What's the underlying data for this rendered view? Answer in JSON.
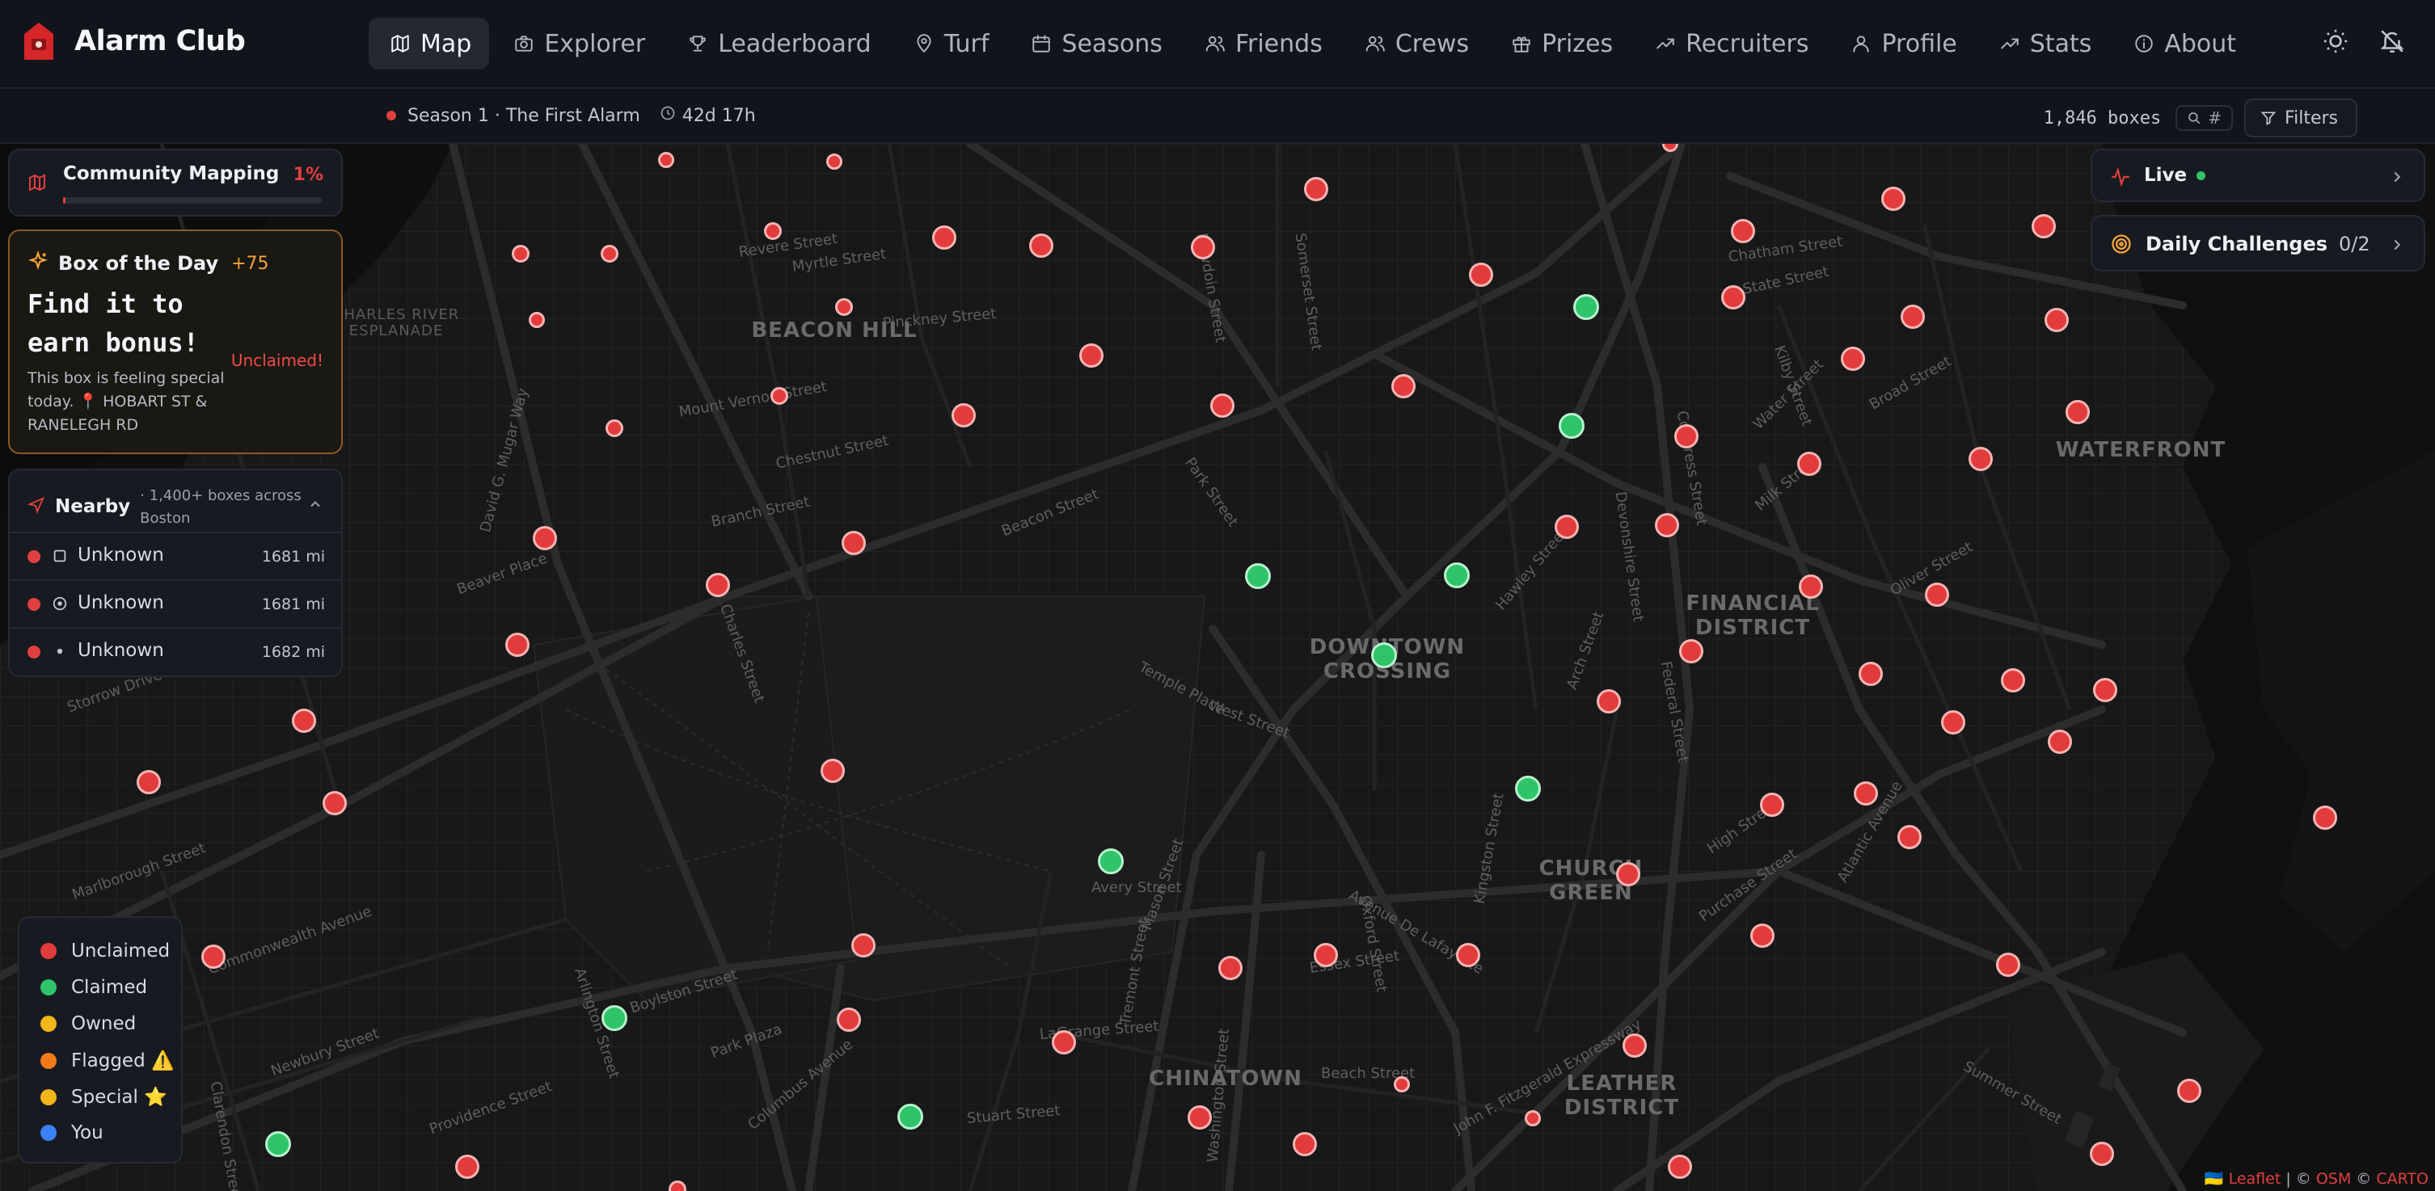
{
  "app": {
    "name": "Alarm Club"
  },
  "nav": {
    "items": [
      {
        "label": "Map",
        "icon": "map-icon",
        "active": true
      },
      {
        "label": "Explorer",
        "icon": "camera-icon"
      },
      {
        "label": "Leaderboard",
        "icon": "trophy-icon"
      },
      {
        "label": "Turf",
        "icon": "pin-icon"
      },
      {
        "label": "Seasons",
        "icon": "calendar-icon"
      },
      {
        "label": "Friends",
        "icon": "users-icon"
      },
      {
        "label": "Crews",
        "icon": "users-icon"
      },
      {
        "label": "Prizes",
        "icon": "gift-icon"
      },
      {
        "label": "Recruiters",
        "icon": "trending-icon"
      },
      {
        "label": "Profile",
        "icon": "user-icon"
      },
      {
        "label": "Stats",
        "icon": "trending-icon"
      },
      {
        "label": "About",
        "icon": "info-icon"
      }
    ]
  },
  "subbar": {
    "season": "Season 1 · The First Alarm",
    "countdown": "42d 17h",
    "box_count": "1,846 boxes",
    "search_hash": "#",
    "filters_label": "Filters"
  },
  "community": {
    "title": "Community Mapping",
    "percent_label": "1%",
    "progress": 0.01
  },
  "box_of_day": {
    "title": "Box of the Day",
    "bonus": "+75",
    "headline": "Find it to earn bonus!",
    "status": "Unclaimed!",
    "description": "This box is feeling special today. 📍 HOBART ST & RANELEGH RD"
  },
  "nearby": {
    "title": "Nearby",
    "subtitle": "· 1,400+ boxes across Boston",
    "items": [
      {
        "name": "Unknown",
        "distance": "1681 mi",
        "icon": "square-icon"
      },
      {
        "name": "Unknown",
        "distance": "1681 mi",
        "icon": "target-icon"
      },
      {
        "name": "Unknown",
        "distance": "1682 mi",
        "icon": "dot-icon"
      }
    ]
  },
  "legend": {
    "items": [
      {
        "label": "Unclaimed",
        "color": "#e23b3b"
      },
      {
        "label": "Claimed",
        "color": "#2fc46a"
      },
      {
        "label": "Owned",
        "color": "#f0b61a"
      },
      {
        "label": "Flagged ⚠️",
        "color": "#f07a1a"
      },
      {
        "label": "Special ⭐",
        "color": "#f0b61a"
      },
      {
        "label": "You",
        "color": "#3b82f6"
      }
    ]
  },
  "live": {
    "label": "Live"
  },
  "daily": {
    "label": "Daily Challenges",
    "count": "0/2"
  },
  "attribution": {
    "leaflet": "🇺🇦 Leaflet",
    "sep": " | © ",
    "osm": "OSM",
    "sep2": " © ",
    "carto": "CARTO"
  },
  "map": {
    "districts": [
      {
        "label": "BEACON HILL"
      },
      {
        "label": "DOWNTOWN CROSSING"
      },
      {
        "label": "FINANCIAL DISTRICT"
      },
      {
        "label": "WATERFRONT"
      },
      {
        "label": "CHURCH GREEN"
      },
      {
        "label": "CHINATOWN"
      },
      {
        "label": "LEATHER DISTRICT"
      },
      {
        "label": "CHARLES RIVER ESPLANADE"
      }
    ],
    "streets": [
      "Beacon Street",
      "Charles Street",
      "Boylston Street",
      "Tremont Street",
      "Commonwealth Avenue",
      "Newbury Street",
      "Marlborough Street",
      "Arlington Street",
      "State Street",
      "Washington Street",
      "Park Street",
      "Devonshire Street",
      "Congress Street",
      "Summer Street",
      "Essex Street",
      "Stuart Street",
      "John F. Fitzgerald Expressway",
      "High Street",
      "Purchase Street",
      "Atlantic Avenue",
      "Broad Street",
      "Milk Street",
      "Federal Street",
      "Kingston Street",
      "Storrow Drive",
      "Myrtle Street",
      "Pinckney Street",
      "Revere Street",
      "Mount Vernon Street",
      "Chestnut Street",
      "Branch Street",
      "Beaver Place",
      "Temple Place",
      "West Street",
      "Avery Street",
      "Mason Street",
      "Park Plaza",
      "LaGrange Street",
      "Beach Street",
      "Providence Street",
      "Clarendon Street",
      "Bowdoin Street",
      "Somerset Street",
      "Arch Street",
      "Oliver Street",
      "Chatham Street",
      "Kilby Street",
      "Water Street",
      "Oxford Street",
      "Avenue De Lafayette",
      "Hawley Street",
      "Columbus Avenue",
      "David G. Mugar Way",
      "Charles River Esplanade"
    ]
  }
}
